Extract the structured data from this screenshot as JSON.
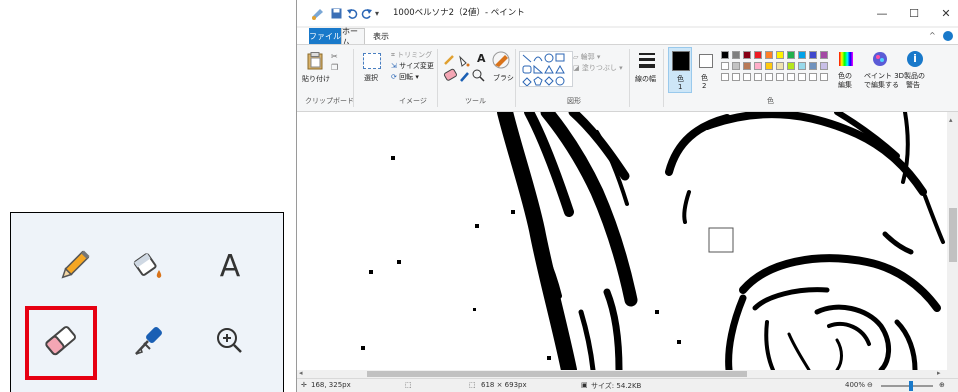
{
  "zoom_panel": {
    "text_tool_glyph": "A",
    "selected_tool": "eraser"
  },
  "window": {
    "title": "1000ベルソナ2（2値）- ペイント",
    "controls": {
      "minimize": "—",
      "maximize": "☐",
      "close": "✕"
    }
  },
  "tabs": [
    {
      "label": "ファイル"
    },
    {
      "label": "ホーム"
    },
    {
      "label": "表示"
    }
  ],
  "ribbon": {
    "clipboard": {
      "paste_label": "貼り付け",
      "group_label": "クリップボード"
    },
    "image": {
      "select_label": "選択",
      "crop_label": "トリミング",
      "resize_label": "サイズ変更",
      "rotate_label": "回転",
      "group_label": "イメージ"
    },
    "tools": {
      "text_glyph": "A",
      "brush_label": "ブラシ",
      "group_label": "ツール"
    },
    "shapes": {
      "outline_label": "輪郭",
      "fill_label": "塗りつぶし",
      "group_label": "図形"
    },
    "size_label": "線の幅",
    "colors": {
      "color1_label": "色",
      "color1_num": "1",
      "color2_label": "色",
      "color2_num": "2",
      "edit_colors_label_1": "色の",
      "edit_colors_label_2": "編集",
      "paint3d_label_1": "ペイント 3D",
      "paint3d_label_2": "で編集する",
      "product_alert_label_1": "製品の",
      "product_alert_label_2": "警告",
      "group_label": "色"
    }
  },
  "statusbar": {
    "cursor_pos": "168, 325px",
    "image_size": "618 × 693px",
    "file_size": "サイズ: 54.2KB",
    "zoom": "400%"
  },
  "colors": {
    "accent": "#1979ca",
    "highlight": "#e60012",
    "canvas_ink": "#000000"
  }
}
